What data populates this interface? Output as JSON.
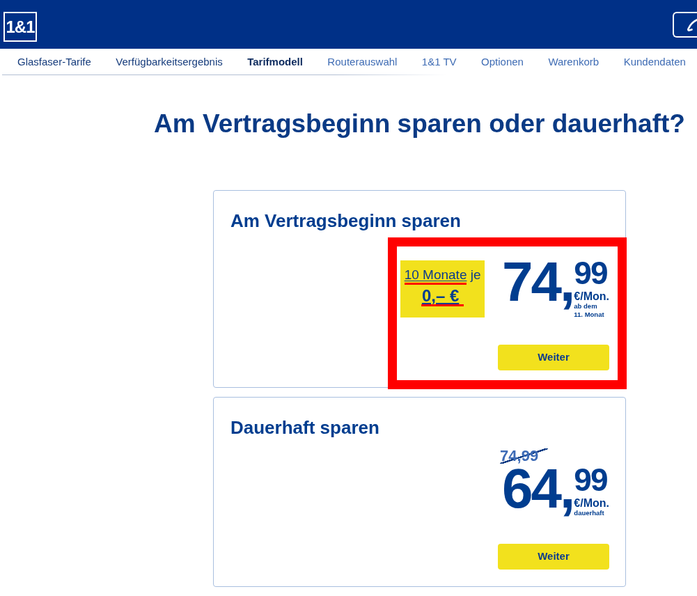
{
  "header": {
    "logo": "1&1"
  },
  "steps": [
    {
      "label": "Glasfaser-Tarife",
      "selected": false,
      "completed": true
    },
    {
      "label": "Verfügbarkeitsergebnis",
      "selected": false,
      "completed": true
    },
    {
      "label": "Tarifmodell",
      "selected": true,
      "completed": false
    },
    {
      "label": "Routerauswahl",
      "selected": false,
      "completed": false
    },
    {
      "label": "1&1 TV",
      "selected": false,
      "completed": false
    },
    {
      "label": "Optionen",
      "selected": false,
      "completed": false
    },
    {
      "label": "Warenkorb",
      "selected": false,
      "completed": false
    },
    {
      "label": "Kundendaten",
      "selected": false,
      "completed": false
    }
  ],
  "heading": "Am Vertragsbeginn sparen oder dauerhaft?",
  "offers": [
    {
      "title": "Am Vertragsbeginn sparen",
      "highlighted": true,
      "promo": {
        "link": "10 Monate",
        "text": "je",
        "amount": "0,– €",
        "marked": true
      },
      "price": {
        "whole": "74,",
        "cents": "99",
        "unit": "€/Mon.",
        "note": "ab dem\n11. Monat"
      },
      "button": "Weiter"
    },
    {
      "title": "Dauerhaft sparen",
      "highlighted": false,
      "old_price": "74,99",
      "price": {
        "whole": "64,",
        "cents": "99",
        "unit": "€/Mon.",
        "note": "dauerhaft"
      },
      "button": "Weiter"
    }
  ]
}
